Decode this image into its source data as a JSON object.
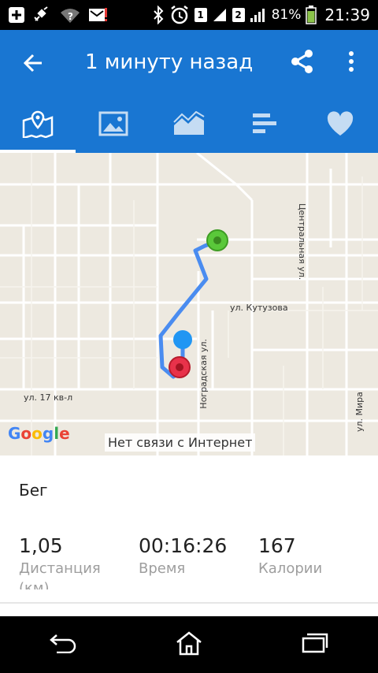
{
  "status_bar": {
    "sim1": "1",
    "sim2": "2",
    "battery": "81%",
    "time": "21:39",
    "icons": [
      "notification-plus-icon",
      "satellite-icon",
      "wifi-question-icon",
      "message-alert-icon",
      "bluetooth-icon",
      "alarm-clock-icon",
      "signal-icon",
      "battery-icon"
    ]
  },
  "app_bar": {
    "title": "1 минуту назад",
    "back_icon": "arrow-left-icon",
    "share_icon": "share-icon",
    "more_icon": "more-vertical-icon"
  },
  "tabs": [
    {
      "name": "map",
      "icon": "map-pin-icon",
      "active": true
    },
    {
      "name": "photos",
      "icon": "image-icon",
      "active": false
    },
    {
      "name": "chart",
      "icon": "area-chart-icon",
      "active": false
    },
    {
      "name": "stats",
      "icon": "bars-icon",
      "active": false
    },
    {
      "name": "favorite",
      "icon": "heart-icon",
      "active": false
    }
  ],
  "map": {
    "streets": {
      "central": "Центральная ул.",
      "kutuzova": "ул. Кутузова",
      "nogradskaya": "Ноградская ул.",
      "kv17": "ул. 17 кв-л",
      "mira": "ул. Мира"
    },
    "logo": "Google",
    "no_connection": "Нет связи с Интернет",
    "colors": {
      "route": "#4a8cf0",
      "start": "#5ac83a",
      "end": "#e8324a",
      "current": "#2196f3"
    }
  },
  "summary": {
    "activity": "Бег",
    "stats": [
      {
        "value": "1,05",
        "label": "Дистанция"
      },
      {
        "value": "00:16:26",
        "label": "Время"
      },
      {
        "value": "167",
        "label": "Калории"
      }
    ],
    "cut_text": "(км)"
  },
  "nav_bar": {
    "icons": [
      "back-nav-icon",
      "home-nav-icon",
      "recents-nav-icon"
    ]
  }
}
